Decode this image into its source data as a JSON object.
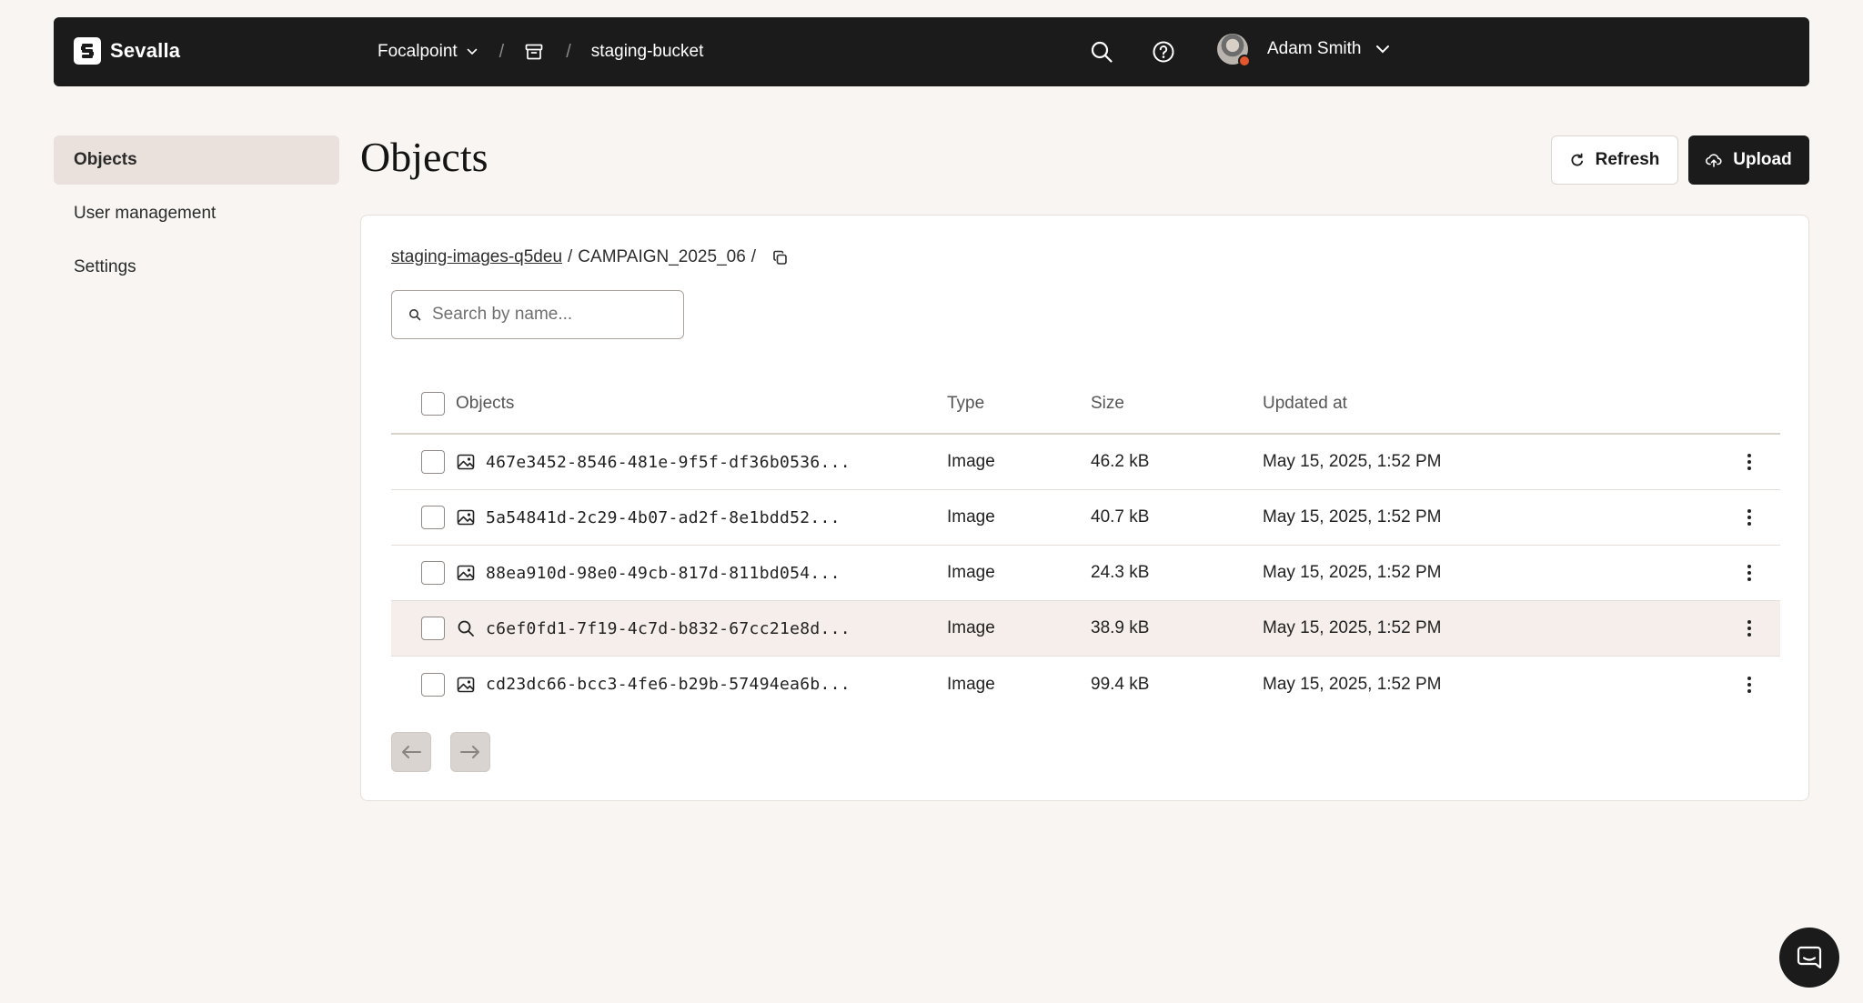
{
  "brand": {
    "name": "Sevalla"
  },
  "breadcrumb": {
    "project": "Focalpoint",
    "separator": "/",
    "bucket": "staging-bucket"
  },
  "user": {
    "name": "Adam Smith"
  },
  "sidebar": {
    "items": [
      {
        "label": "Objects",
        "active": true
      },
      {
        "label": "User management",
        "active": false
      },
      {
        "label": "Settings",
        "active": false
      }
    ]
  },
  "page": {
    "title": "Objects"
  },
  "actions": {
    "refresh_label": "Refresh",
    "upload_label": "Upload"
  },
  "path": {
    "root": "staging-images-q5deu",
    "folder": "CAMPAIGN_2025_06",
    "separator": "/"
  },
  "search": {
    "placeholder": "Search by name...",
    "value": ""
  },
  "table": {
    "columns": {
      "name": "Objects",
      "type": "Type",
      "size": "Size",
      "updated": "Updated at"
    },
    "rows": [
      {
        "name": "467e3452-8546-481e-9f5f-df36b0536...",
        "type": "Image",
        "size": "46.2 kB",
        "updated": "May 15, 2025, 1:52 PM",
        "icon": "image-icon"
      },
      {
        "name": "5a54841d-2c29-4b07-ad2f-8e1bdd52...",
        "type": "Image",
        "size": "40.7 kB",
        "updated": "May 15, 2025, 1:52 PM",
        "icon": "image-icon"
      },
      {
        "name": "88ea910d-98e0-49cb-817d-811bd054...",
        "type": "Image",
        "size": "24.3 kB",
        "updated": "May 15, 2025, 1:52 PM",
        "icon": "image-icon"
      },
      {
        "name": "c6ef0fd1-7f19-4c7d-b832-67cc21e8d...",
        "type": "Image",
        "size": "38.9 kB",
        "updated": "May 15, 2025, 1:52 PM",
        "icon": "search-icon"
      },
      {
        "name": "cd23dc66-bcc3-4fe6-b29b-57494ea6b...",
        "type": "Image",
        "size": "99.4 kB",
        "updated": "May 15, 2025, 1:52 PM",
        "icon": "image-icon"
      }
    ]
  },
  "colors": {
    "topbar": "#1b1b1b",
    "background": "#f8f5f2",
    "active_nav": "#ebe1dc",
    "row_hover": "#f5eeeb",
    "avatar_badge": "#e4572e"
  }
}
